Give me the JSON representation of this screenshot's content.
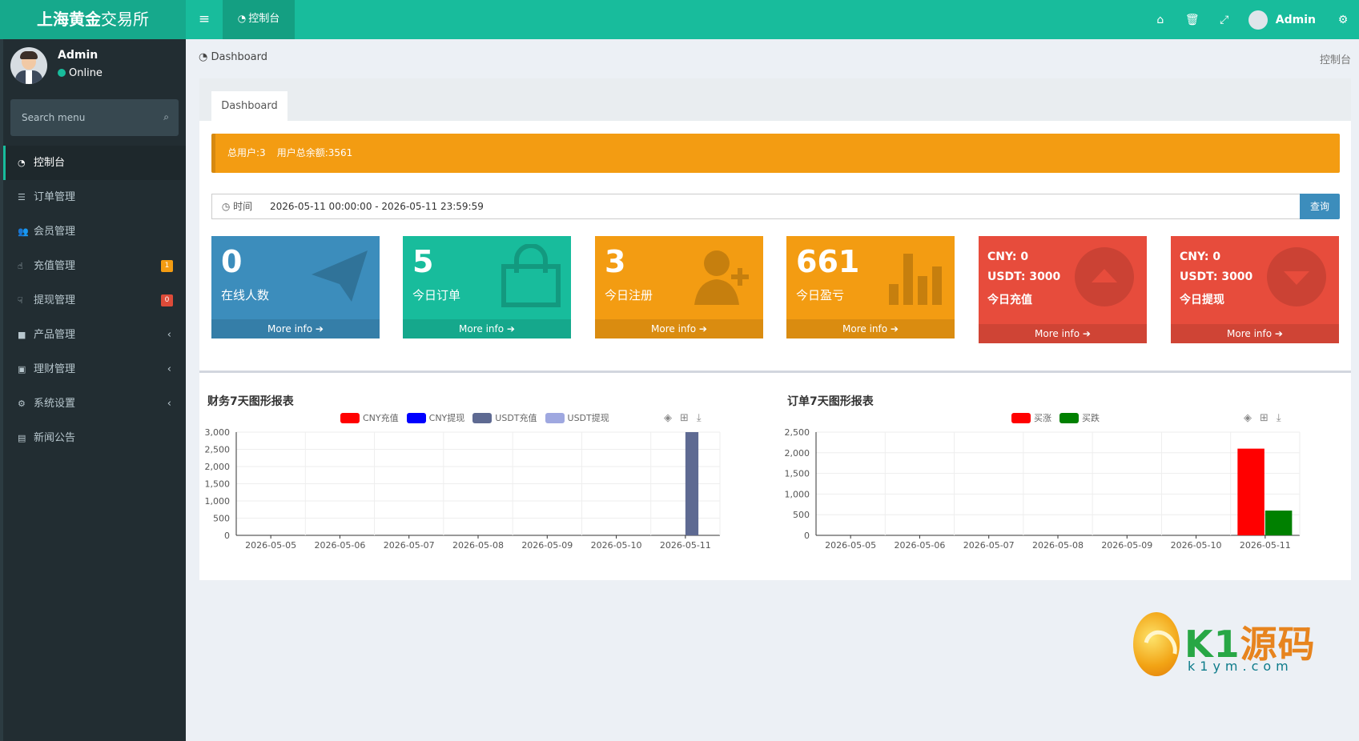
{
  "topbar": {
    "logo_bold": "上海黄金",
    "logo_rest": "交易所",
    "menu_toggle": "≡",
    "tab_label": "控制台",
    "user_name": "Admin"
  },
  "sidebar": {
    "user_name": "Admin",
    "status": "Online",
    "search_placeholder": "Search menu",
    "items": [
      {
        "label": "控制台",
        "icon": "dashboard-icon"
      },
      {
        "label": "订单管理",
        "icon": "list-icon"
      },
      {
        "label": "会员管理",
        "icon": "users-icon"
      },
      {
        "label": "充值管理",
        "icon": "recharge-icon",
        "badge": "1",
        "badge_color": "#f39c12"
      },
      {
        "label": "提现管理",
        "icon": "withdraw-icon",
        "badge": "0",
        "badge_color": "#dd4b39"
      },
      {
        "label": "产品管理",
        "icon": "briefcase-icon",
        "chevron": "‹"
      },
      {
        "label": "理财管理",
        "icon": "money-icon",
        "chevron": "‹"
      },
      {
        "label": "系统设置",
        "icon": "cogs-icon",
        "chevron": "‹"
      },
      {
        "label": "新闻公告",
        "icon": "newspaper-icon"
      }
    ]
  },
  "breadcrumb": {
    "label": "Dashboard",
    "right": "控制台"
  },
  "box": {
    "tab": "Dashboard",
    "alert": {
      "users": "总用户:3",
      "balance": "用户总余额:3561"
    },
    "date": {
      "label": "时间",
      "value": "2026-05-11 00:00:00 - 2026-05-11 23:59:59",
      "button": "查询"
    }
  },
  "cards": [
    {
      "value": "0",
      "label": "在线人数",
      "more": "More info",
      "color": "#3c8dbc"
    },
    {
      "value": "5",
      "label": "今日订单",
      "more": "More info",
      "color": "#18bc9c"
    },
    {
      "value": "3",
      "label": "今日注册",
      "more": "More info",
      "color": "#f39c12"
    },
    {
      "value": "661",
      "label": "今日盈亏",
      "more": "More info",
      "color": "#f39c12"
    },
    {
      "cny": "CNY:  0",
      "usdt": "USDT:  3000",
      "label": "今日充值",
      "more": "More info",
      "color": "#e74c3c"
    },
    {
      "cny": "CNY:  0",
      "usdt": "USDT:  3000",
      "label": "今日提现",
      "more": "More info",
      "color": "#e74c3c"
    }
  ],
  "chart_data": [
    {
      "type": "bar",
      "title": "财务7天图形报表",
      "categories": [
        "2026-05-05",
        "2026-05-06",
        "2026-05-07",
        "2026-05-08",
        "2026-05-09",
        "2026-05-10",
        "2026-05-11"
      ],
      "ylim": [
        0,
        3000
      ],
      "yticks": [
        "0",
        "500",
        "1,000",
        "1,500",
        "2,000",
        "2,500",
        "3,000"
      ],
      "legend_position": "top-center",
      "series": [
        {
          "name": "CNY充值",
          "color": "#ff0000",
          "values": [
            0,
            0,
            0,
            0,
            0,
            0,
            0
          ]
        },
        {
          "name": "CNY提现",
          "color": "#0000ff",
          "values": [
            0,
            0,
            0,
            0,
            0,
            0,
            0
          ]
        },
        {
          "name": "USDT充值",
          "color": "#5e6a92",
          "values": [
            0,
            0,
            0,
            0,
            0,
            0,
            3000
          ]
        },
        {
          "name": "USDT提现",
          "color": "#9fa8e0",
          "values": [
            0,
            0,
            0,
            0,
            0,
            0,
            0
          ]
        }
      ]
    },
    {
      "type": "bar",
      "title": "订单7天图形报表",
      "categories": [
        "2026-05-05",
        "2026-05-06",
        "2026-05-07",
        "2026-05-08",
        "2026-05-09",
        "2026-05-10",
        "2026-05-11"
      ],
      "ylim": [
        0,
        2500
      ],
      "yticks": [
        "0",
        "500",
        "1,000",
        "1,500",
        "2,000",
        "2,500"
      ],
      "legend_position": "top-center",
      "series": [
        {
          "name": "买涨",
          "color": "#ff0000",
          "values": [
            0,
            0,
            0,
            0,
            0,
            0,
            2100
          ]
        },
        {
          "name": "买跌",
          "color": "#008000",
          "values": [
            0,
            0,
            0,
            0,
            0,
            0,
            600
          ]
        }
      ]
    }
  ],
  "watermark": {
    "brand_a": "K1",
    "brand_b": "源码",
    "url": "k1ym.com"
  }
}
